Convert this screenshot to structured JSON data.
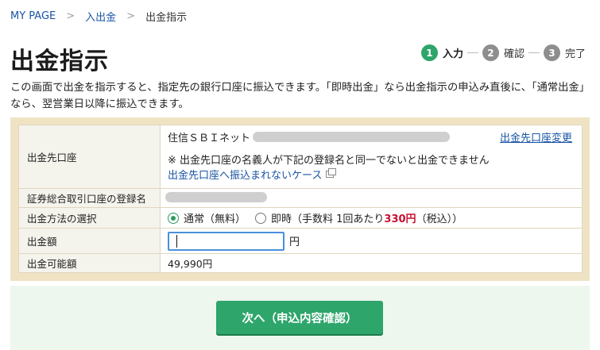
{
  "breadcrumb": {
    "items": [
      {
        "label": "MY PAGE"
      },
      {
        "label": "入出金"
      },
      {
        "label": "出金指示"
      }
    ],
    "separator": ">"
  },
  "page": {
    "title": "出金指示",
    "description": "この画面で出金を指示すると、指定先の銀行口座に振込できます。「即時出金」なら出金指示の申込み直後に、「通常出金」なら、翌営業日以降に振込できます。"
  },
  "steps": [
    {
      "num": "1",
      "label": "入力",
      "color": "#2ea56b"
    },
    {
      "num": "2",
      "label": "確認",
      "color": "#8e8e8e"
    },
    {
      "num": "3",
      "label": "完了",
      "color": "#8e8e8e"
    }
  ],
  "form": {
    "destination": {
      "label": "出金先口座",
      "bank_prefix": "住信ＳＢＩネット",
      "change_link": "出金先口座変更",
      "note": "※ 出金先口座の名義人が下記の登録名と同一でないと出金できません",
      "help_link": "出金先口座へ振込まれないケース"
    },
    "registered_name": {
      "label": "証券総合取引口座の登録名"
    },
    "method": {
      "label": "出金方法の選択",
      "options": [
        {
          "label": "通常（無料）",
          "checked": true
        },
        {
          "label_prefix": "即時（手数料 1回あたり",
          "fee": "330円",
          "label_suffix": "（税込））",
          "checked": false
        }
      ]
    },
    "amount": {
      "label": "出金額",
      "value": "",
      "unit": "円"
    },
    "available": {
      "label": "出金可能額",
      "value": "49,990円"
    }
  },
  "actions": {
    "next_label": "次へ（申込内容確認）"
  },
  "colors": {
    "accent_green": "#2ea56b",
    "link_blue": "#1a55a6",
    "fee_red": "#c8102e",
    "panel_beige": "#efe3c4"
  }
}
